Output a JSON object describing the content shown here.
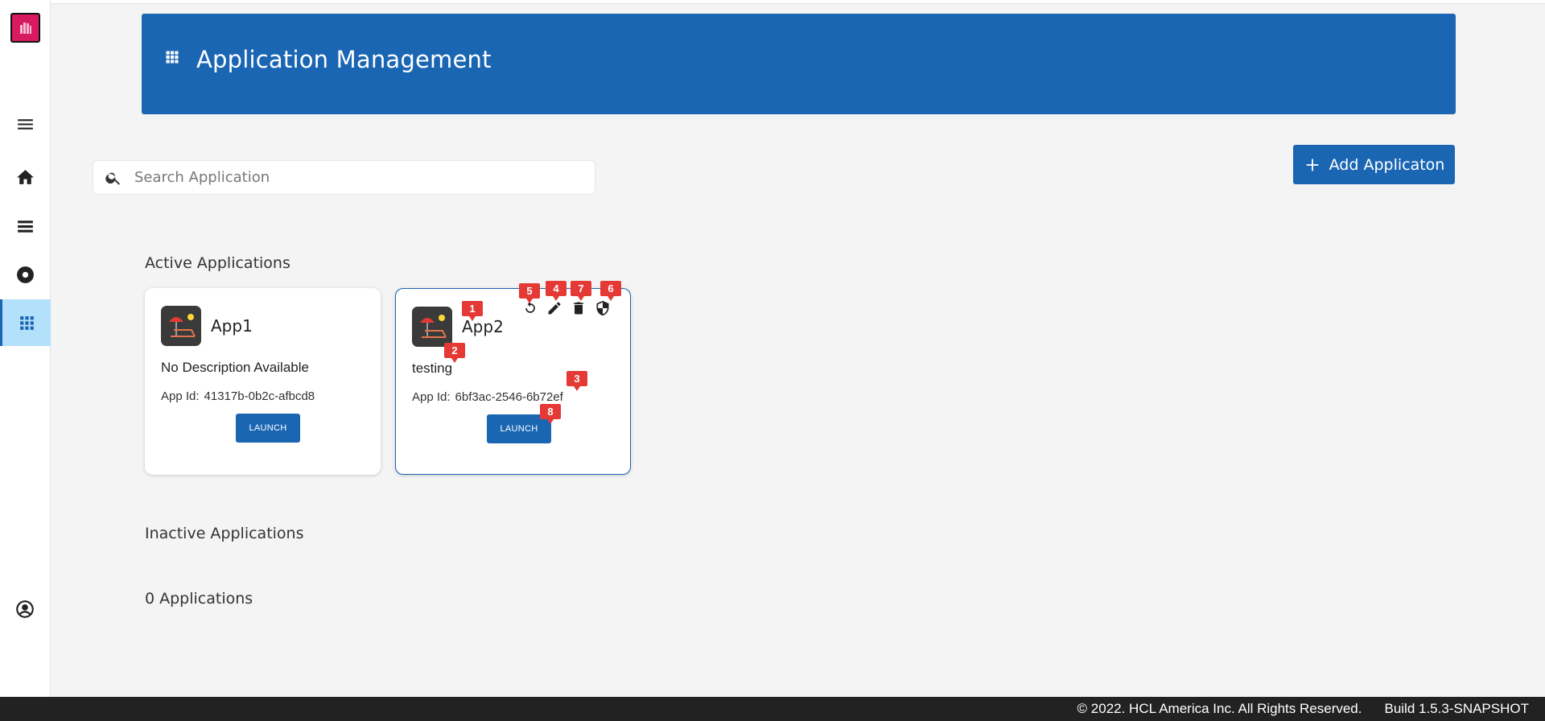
{
  "header": {
    "title": "Application Management"
  },
  "search": {
    "placeholder": "Search Application",
    "value": ""
  },
  "toolbar": {
    "add_label": "Add Applicaton"
  },
  "sections": {
    "active_title": "Active Applications",
    "inactive_title": "Inactive Applications",
    "inactive_count": "0 Applications"
  },
  "apps": [
    {
      "name": "App1",
      "description": "No Description Available",
      "id_label": "App Id:",
      "id": "41317b-0b2c-afbcd8",
      "launch_label": "LAUNCH"
    },
    {
      "name": "App2",
      "description": "testing",
      "id_label": "App Id:",
      "id": "6bf3ac-2546-6b72ef",
      "launch_label": "LAUNCH"
    }
  ],
  "markers": [
    "1",
    "2",
    "3",
    "4",
    "5",
    "6",
    "7",
    "8"
  ],
  "footer": {
    "copyright": "© 2022. HCL America Inc. All Rights Reserved.",
    "build": "Build 1.5.3-SNAPSHOT"
  },
  "colors": {
    "primary": "#1a66b3",
    "marker": "#e53935",
    "footer_bg": "#222222",
    "active_nav_bg": "#b3e0fb"
  },
  "icons": [
    "logo-icon",
    "menu-icon",
    "home-icon",
    "list-icon",
    "disc-icon",
    "apps-grid-icon",
    "user-circle-icon",
    "search-icon",
    "plus-icon",
    "refresh-icon",
    "edit-icon",
    "delete-icon",
    "shield-icon"
  ]
}
